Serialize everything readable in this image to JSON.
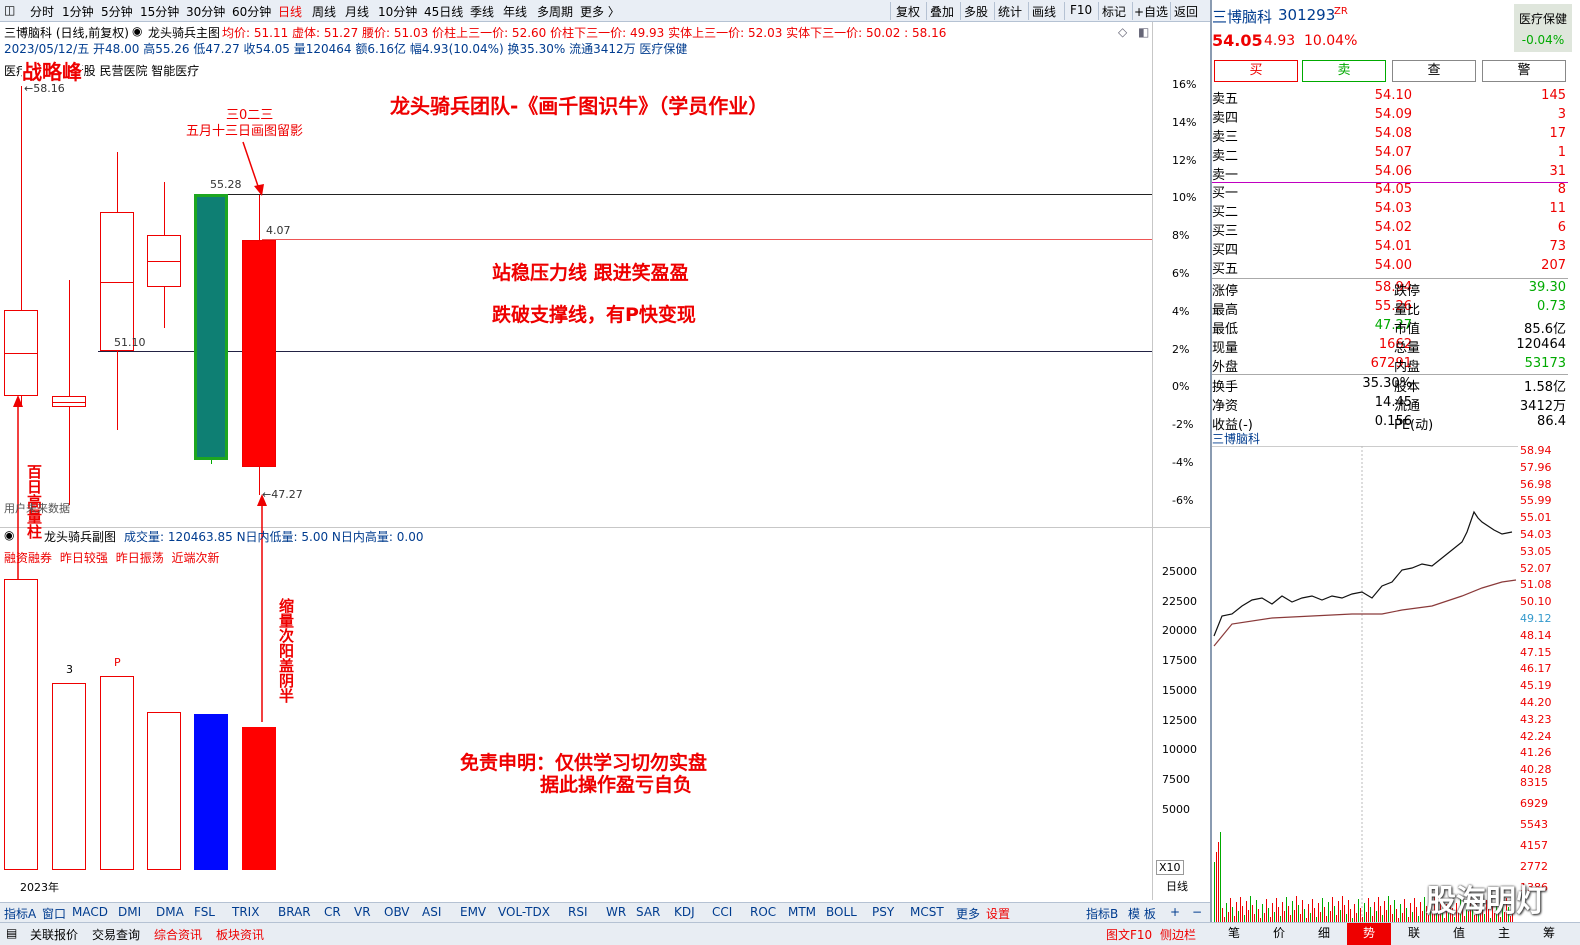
{
  "toolbar": {
    "periods": [
      "分时",
      "1分钟",
      "5分钟",
      "15分钟",
      "30分钟",
      "60分钟",
      "日线",
      "周线",
      "月线",
      "10分钟",
      "45日线",
      "季线",
      "年线",
      "多周期",
      "更多 〉"
    ],
    "active_period": "日线",
    "right_tools": [
      "复权",
      "叠加",
      "多股",
      "统计",
      "画线",
      "F10",
      "标记",
      "+自选",
      "返回"
    ]
  },
  "main_chart": {
    "header_name": "三博脑科 (日线,前复权)",
    "indicator_name": "龙头骑兵主图",
    "indicator_values": "均价: 51.11  虚体: 51.27  腰价: 51.03  价柱上三一价: 52.60  价柱下三一价: 49.93  实体上三一价: 52.03  实体下三一价: 50.02 : 58.16",
    "bar_info": "2023/05/12/五 开48.00 高55.26 低47.27 收54.05 量120464 额6.16亿 幅4.93(10.04%) 换35.30% 流通3412万 医疗保健",
    "concept_row": "医疗 板块 次新股 民营医院 智能医疗",
    "title_annotation": "龙头骑兵团队-《画千图识牛》（学员作业）",
    "author_tag": "战略峰",
    "date_note_1": "三0二三",
    "date_note_2": "五月十三日画图留影",
    "strategy_1": "站稳压力线  跟进笑盈盈",
    "strategy_2": "跌破支撑线，有P快变现",
    "disclaimer_1": "免责申明：仅供学习切勿实盘",
    "disclaimer_2": "据此操作盈亏自负",
    "volume_note": "缩量次阳盖阴半",
    "hundred_note": "百日高量柱",
    "hidden_note": "用户未来数据",
    "price_labels": {
      "high": "58.16",
      "mark_55": "55.28",
      "mark_51": "51.10",
      "low": "47.27",
      "mark_54": "4.07"
    },
    "pct_axis": [
      "16%",
      "14%",
      "12%",
      "10%",
      "8%",
      "6%",
      "4%",
      "2%",
      "0%",
      "-2%",
      "-4%",
      "-6%"
    ],
    "year_label": "2023年"
  },
  "chart_data": {
    "type": "candlestick",
    "candles": [
      {
        "open": 49.9,
        "high": 58.16,
        "low": 49.6,
        "close": 52.2,
        "color": "red-hollow"
      },
      {
        "open": 49.6,
        "high": 53.0,
        "low": 47.0,
        "close": 49.9,
        "color": "red-hollow"
      },
      {
        "open": 51.1,
        "high": 56.4,
        "low": 49.0,
        "close": 54.8,
        "color": "red-hollow"
      },
      {
        "open": 52.8,
        "high": 55.6,
        "low": 51.7,
        "close": 54.2,
        "color": "red-hollow"
      },
      {
        "open": 55.28,
        "high": 55.28,
        "low": 48.1,
        "close": 48.2,
        "color": "green"
      },
      {
        "open": 48.0,
        "high": 55.26,
        "low": 47.27,
        "close": 54.05,
        "color": "red"
      }
    ],
    "resistance_line": 55.28,
    "support_line": 51.1,
    "volume": {
      "indicator": "龙头骑兵副图",
      "info": "成交量: 120463.85  N日内低量: 5.00  N日内高量: 0.00",
      "sub_tabs": [
        "融资融券",
        "昨日较强",
        "昨日振荡",
        "近端次新"
      ],
      "axis": [
        "25000",
        "22500",
        "20000",
        "17500",
        "15000",
        "12500",
        "10000",
        "7500",
        "5000"
      ],
      "bars": [
        {
          "label": "",
          "value": 24500
        },
        {
          "label": "3",
          "value": 15700
        },
        {
          "label": "P",
          "value": 16300
        },
        {
          "label": "",
          "value": 13300
        },
        {
          "label": "",
          "value": 13100
        },
        {
          "label": "",
          "value": 12000
        }
      ],
      "x10": "X10",
      "period_tag": "日线"
    }
  },
  "indicator_tabs": [
    "指标A",
    "窗口",
    "MACD",
    "DMI",
    "DMA",
    "FSL",
    "TRIX",
    "BRAR",
    "CR",
    "VR",
    "OBV",
    "ASI",
    "EMV",
    "VOL-TDX",
    "RSI",
    "WR",
    "SAR",
    "KDJ",
    "CCI",
    "ROC",
    "MTM",
    "BOLL",
    "PSY",
    "MCST",
    "更多",
    "设置"
  ],
  "indicator_tabs_right": [
    "指标B",
    "模 板",
    "+",
    "−"
  ],
  "bottom_tabs": [
    "关联报价",
    "交易查询",
    "综合资讯",
    "板块资讯"
  ],
  "bottom_right": [
    "图文F10",
    "侧边栏"
  ],
  "quote": {
    "name": "三博脑科",
    "code": "301293",
    "tag": "ZR",
    "sector": "医疗保健",
    "sector_change": "-0.04%",
    "price": "54.05",
    "change": "4.93",
    "change_pct": "10.04%",
    "actions": [
      "买",
      "卖",
      "查",
      "警"
    ],
    "asks": [
      {
        "label": "卖五",
        "price": "54.10",
        "vol": "145"
      },
      {
        "label": "卖四",
        "price": "54.09",
        "vol": "3"
      },
      {
        "label": "卖三",
        "price": "54.08",
        "vol": "17"
      },
      {
        "label": "卖二",
        "price": "54.07",
        "vol": "1"
      },
      {
        "label": "卖一",
        "price": "54.06",
        "vol": "31"
      }
    ],
    "bids": [
      {
        "label": "买一",
        "price": "54.05",
        "vol": "8"
      },
      {
        "label": "买二",
        "price": "54.03",
        "vol": "11"
      },
      {
        "label": "买三",
        "price": "54.02",
        "vol": "6"
      },
      {
        "label": "买四",
        "price": "54.01",
        "vol": "73"
      },
      {
        "label": "买五",
        "price": "54.00",
        "vol": "207"
      }
    ],
    "stats": [
      {
        "l1": "涨停",
        "v1": "58.94",
        "l2": "跌停",
        "v2": "39.30"
      },
      {
        "l1": "最高",
        "v1": "55.26",
        "l2": "量比",
        "v2": "0.73"
      },
      {
        "l1": "最低",
        "v1": "47.27",
        "l2": "市值",
        "v2": "85.6亿"
      },
      {
        "l1": "现量",
        "v1": "1662",
        "l2": "总量",
        "v2": "120464"
      },
      {
        "l1": "外盘",
        "v1": "67291",
        "l2": "内盘",
        "v2": "53173"
      }
    ],
    "stats2": [
      {
        "l1": "换手",
        "v1": "35.30%",
        "l2": "股本",
        "v2": "1.58亿"
      },
      {
        "l1": "净资",
        "v1": "14.45",
        "l2": "流通",
        "v2": "3412万"
      },
      {
        "l1": "收益(-)",
        "v1": "0.156",
        "l2": "PE(动)",
        "v2": "86.4"
      }
    ]
  },
  "intraday": {
    "title": "三博脑科",
    "price_axis": [
      "58.94",
      "57.96",
      "56.98",
      "55.99",
      "55.01",
      "54.03",
      "53.05",
      "52.07",
      "51.08",
      "50.10",
      "49.12",
      "48.14",
      "47.15",
      "46.17",
      "45.19",
      "44.20",
      "43.23",
      "42.24",
      "41.26",
      "40.28"
    ],
    "vol_axis": [
      "8315",
      "6929",
      "5543",
      "4157",
      "2772",
      "1386"
    ],
    "tabs": [
      "笔",
      "价",
      "细",
      "势",
      "联",
      "值",
      "主",
      "筹"
    ],
    "active_tab": "势",
    "watermark": "股海明灯"
  }
}
